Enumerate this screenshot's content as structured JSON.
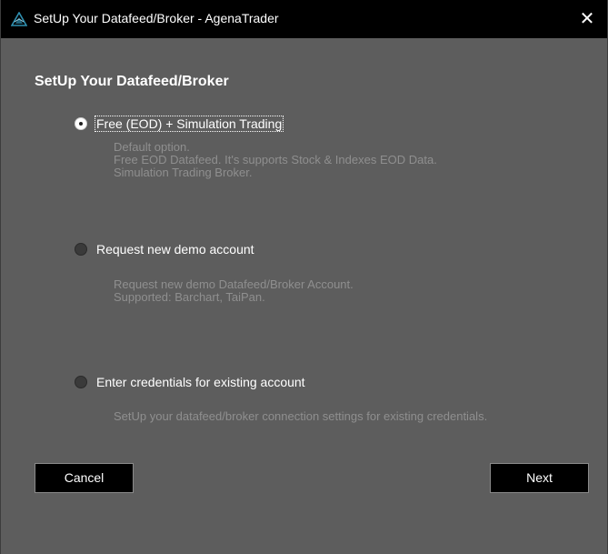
{
  "window": {
    "title": "SetUp Your Datafeed/Broker - AgenaTrader",
    "close_glyph": "✕"
  },
  "heading": "SetUp Your Datafeed/Broker",
  "options": [
    {
      "label": "Free (EOD) + Simulation Trading",
      "selected": true,
      "description": [
        "Default option.",
        "Free EOD Datafeed. It's supports Stock & Indexes EOD Data.",
        "Simulation Trading Broker."
      ]
    },
    {
      "label": "Request new demo account",
      "selected": false,
      "description": [
        "Request new demo Datafeed/Broker Account.",
        "Supported: Barchart, TaiPan."
      ]
    },
    {
      "label": "Enter credentials for existing account",
      "selected": false,
      "description": [
        "SetUp your datafeed/broker connection settings for existing credentials."
      ]
    }
  ],
  "buttons": {
    "cancel": "Cancel",
    "next": "Next"
  },
  "colors": {
    "background": "#5d5d5d",
    "titlebar": "#000000",
    "description_text": "#8f8f8f",
    "logo_accent": "#2f8fb0"
  },
  "icons": {
    "app": "agenatrader-logo-icon",
    "close": "close-icon"
  }
}
